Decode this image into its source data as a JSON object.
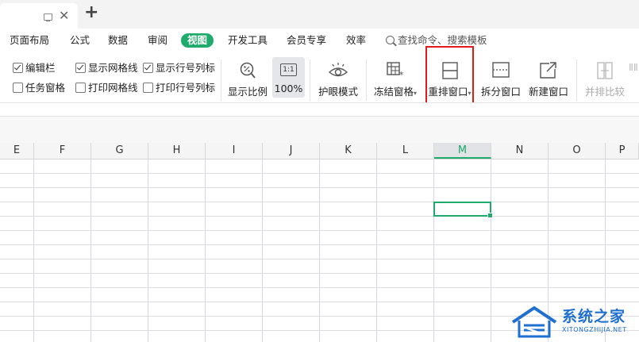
{
  "titlebar": {
    "new_tab": "+"
  },
  "menu": {
    "items": [
      "页面布局",
      "公式",
      "数据",
      "审阅",
      "视图",
      "开发工具",
      "会员专享",
      "效率"
    ],
    "active": "视图",
    "search_placeholder": "查找命令、搜索模板"
  },
  "ribbon": {
    "checkboxes": [
      {
        "label": "编辑栏",
        "checked": true
      },
      {
        "label": "显示网格线",
        "checked": true
      },
      {
        "label": "显示行号列标",
        "checked": true
      },
      {
        "label": "任务窗格",
        "checked": false
      },
      {
        "label": "打印网格线",
        "checked": false
      },
      {
        "label": "打印行号列标",
        "checked": false
      }
    ],
    "buttons": {
      "zoom_ratio": "显示比例",
      "zoom_100_icon": "1:1",
      "zoom_100": "100%",
      "eye_mode": "护眼模式",
      "freeze": "冻结窗格",
      "rearrange": "重排窗口",
      "split": "拆分窗口",
      "new_window": "新建窗口",
      "side_by_side": "并排比较",
      "cut_label": "ⅡⅡ"
    }
  },
  "sheet": {
    "columns": [
      "E",
      "F",
      "G",
      "H",
      "I",
      "J",
      "K",
      "L",
      "M",
      "N",
      "O",
      "P"
    ],
    "active_column": "M"
  },
  "watermark": {
    "title": "系统之家",
    "subtitle": "XITONGZHIJIA.NET"
  },
  "colors": {
    "accent": "#1fab6b",
    "highlight": "#e41a1a",
    "brand": "#1e6fd0"
  }
}
